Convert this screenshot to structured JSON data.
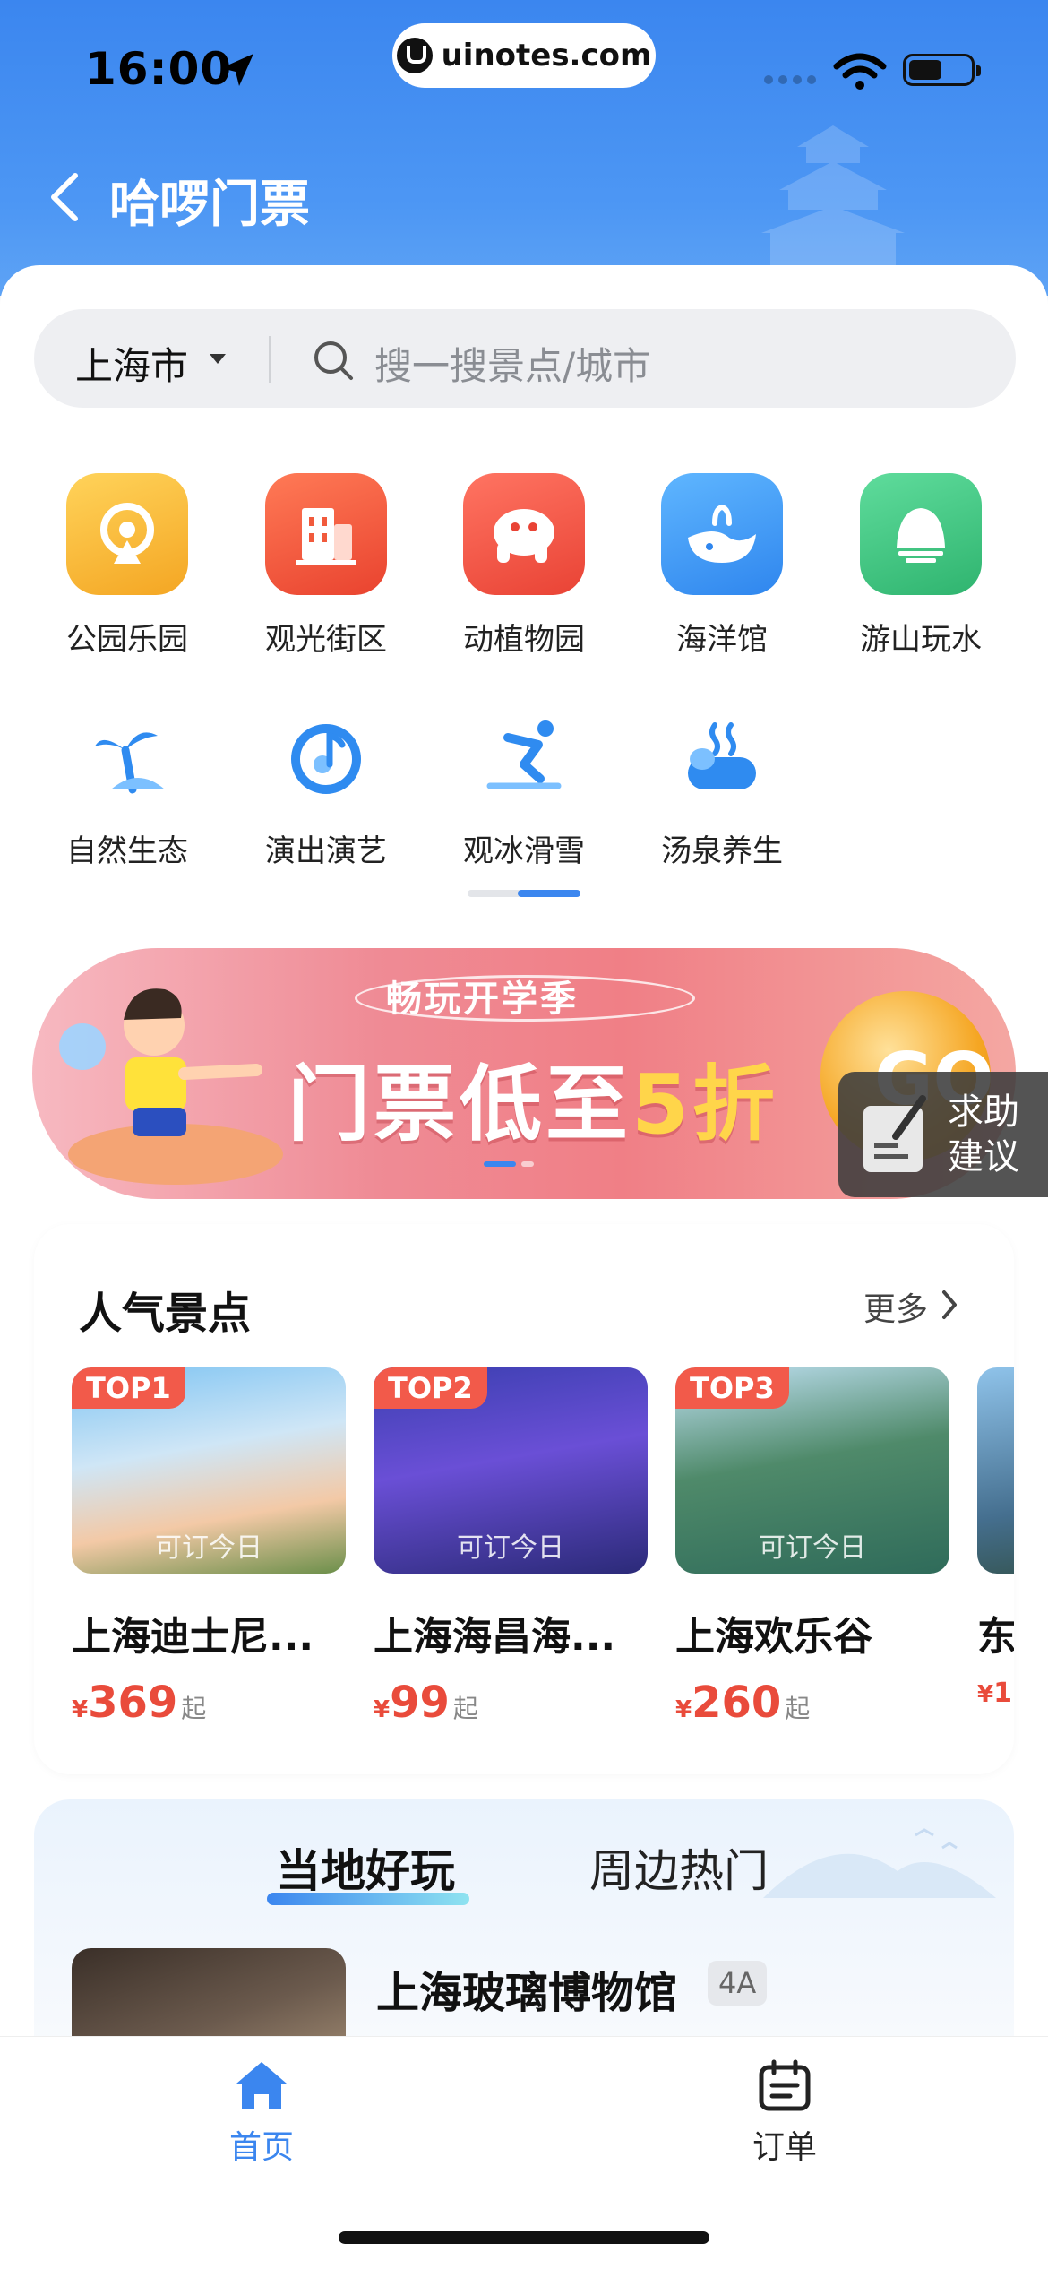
{
  "status": {
    "time": "16:00",
    "url": "uinotes.com"
  },
  "header": {
    "title": "哈啰门票"
  },
  "search": {
    "city": "上海市",
    "placeholder": "搜一搜景点/城市"
  },
  "categories": [
    {
      "label": "公园乐园",
      "icon": "ferris-wheel-icon",
      "color": "#f6b53a"
    },
    {
      "label": "观光街区",
      "icon": "building-icon",
      "color": "#ef5a3c"
    },
    {
      "label": "动植物园",
      "icon": "elephant-icon",
      "color": "#f1543f"
    },
    {
      "label": "海洋馆",
      "icon": "whale-icon",
      "color": "#3d9bf2"
    },
    {
      "label": "游山玩水",
      "icon": "mountain-icon",
      "color": "#3fc784"
    },
    {
      "label": "自然生态",
      "icon": "palm-tree-icon",
      "color": "#2f8bf0"
    },
    {
      "label": "演出演艺",
      "icon": "music-note-icon",
      "color": "#2f8bf0"
    },
    {
      "label": "观冰滑雪",
      "icon": "skier-icon",
      "color": "#2f8bf0"
    },
    {
      "label": "汤泉养生",
      "icon": "hot-spring-icon",
      "color": "#2f8bf0"
    }
  ],
  "banner": {
    "subtitle": "畅玩开学季",
    "main_prefix": "门票低至",
    "main_highlight": "5折",
    "go": "GO"
  },
  "help": {
    "line1": "求助",
    "line2": "建议"
  },
  "popular": {
    "title": "人气景点",
    "more": "更多",
    "items": [
      {
        "rank": "TOP1",
        "avail": "可订今日",
        "name": "上海迪士尼...",
        "yen": "¥",
        "price": "369",
        "suffix": "起"
      },
      {
        "rank": "TOP2",
        "avail": "可订今日",
        "name": "上海海昌海...",
        "yen": "¥",
        "price": "99",
        "suffix": "起"
      },
      {
        "rank": "TOP3",
        "avail": "可订今日",
        "name": "上海欢乐谷",
        "yen": "¥",
        "price": "260",
        "suffix": "起"
      },
      {
        "rank": "",
        "avail": "",
        "name": "东",
        "yen": "¥",
        "price": "1",
        "suffix": ""
      }
    ]
  },
  "local": {
    "tabs": [
      "当地好玩",
      "周边热门"
    ],
    "first_item": {
      "name": "上海玻璃博物馆",
      "badge": "4A"
    }
  },
  "bottom_nav": [
    {
      "label": "首页",
      "active": true
    },
    {
      "label": "订单",
      "active": false
    }
  ],
  "colors": {
    "accent": "#3b86ef",
    "price": "#e94b3b"
  }
}
